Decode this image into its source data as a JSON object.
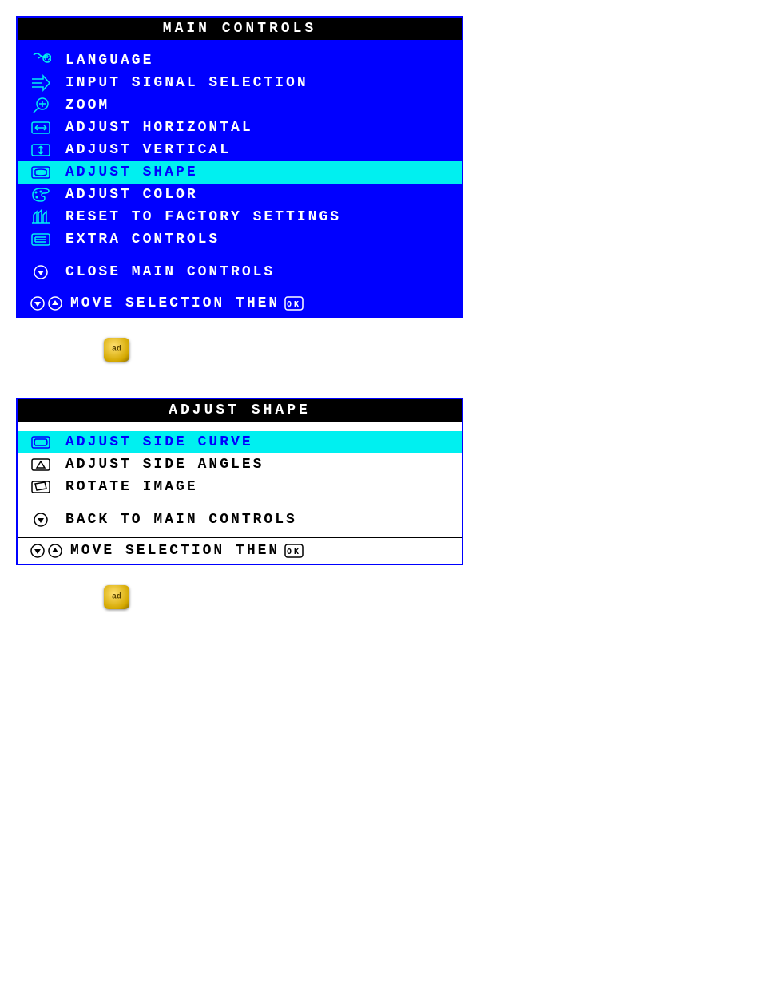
{
  "window1": {
    "title": "MAIN CONTROLS",
    "items": [
      {
        "icon": "language-icon",
        "label": "LANGUAGE",
        "highlighted": false
      },
      {
        "icon": "input-icon",
        "label": "INPUT SIGNAL SELECTION",
        "highlighted": false
      },
      {
        "icon": "zoom-icon",
        "label": "ZOOM",
        "highlighted": false
      },
      {
        "icon": "horizontal-icon",
        "label": "ADJUST HORIZONTAL",
        "highlighted": false
      },
      {
        "icon": "vertical-icon",
        "label": "ADJUST VERTICAL",
        "highlighted": false
      },
      {
        "icon": "shape-icon",
        "label": "ADJUST SHAPE",
        "highlighted": true
      },
      {
        "icon": "color-icon",
        "label": "ADJUST COLOR",
        "highlighted": false
      },
      {
        "icon": "reset-icon",
        "label": "RESET TO FACTORY SETTINGS",
        "highlighted": false
      },
      {
        "icon": "extra-icon",
        "label": "EXTRA CONTROLS",
        "highlighted": false
      }
    ],
    "close_label": "CLOSE MAIN CONTROLS",
    "footer_text": "MOVE SELECTION THEN",
    "footer_ok": "OK"
  },
  "window2": {
    "title": "ADJUST SHAPE",
    "items": [
      {
        "icon": "side-curve-icon",
        "label": "ADJUST SIDE CURVE",
        "highlighted": true
      },
      {
        "icon": "side-angles-icon",
        "label": "ADJUST SIDE ANGLES",
        "highlighted": false
      },
      {
        "icon": "rotate-icon",
        "label": "ROTATE IMAGE",
        "highlighted": false
      }
    ],
    "back_label": "BACK TO MAIN CONTROLS",
    "footer_text": "MOVE SELECTION THEN",
    "footer_ok": "OK"
  }
}
